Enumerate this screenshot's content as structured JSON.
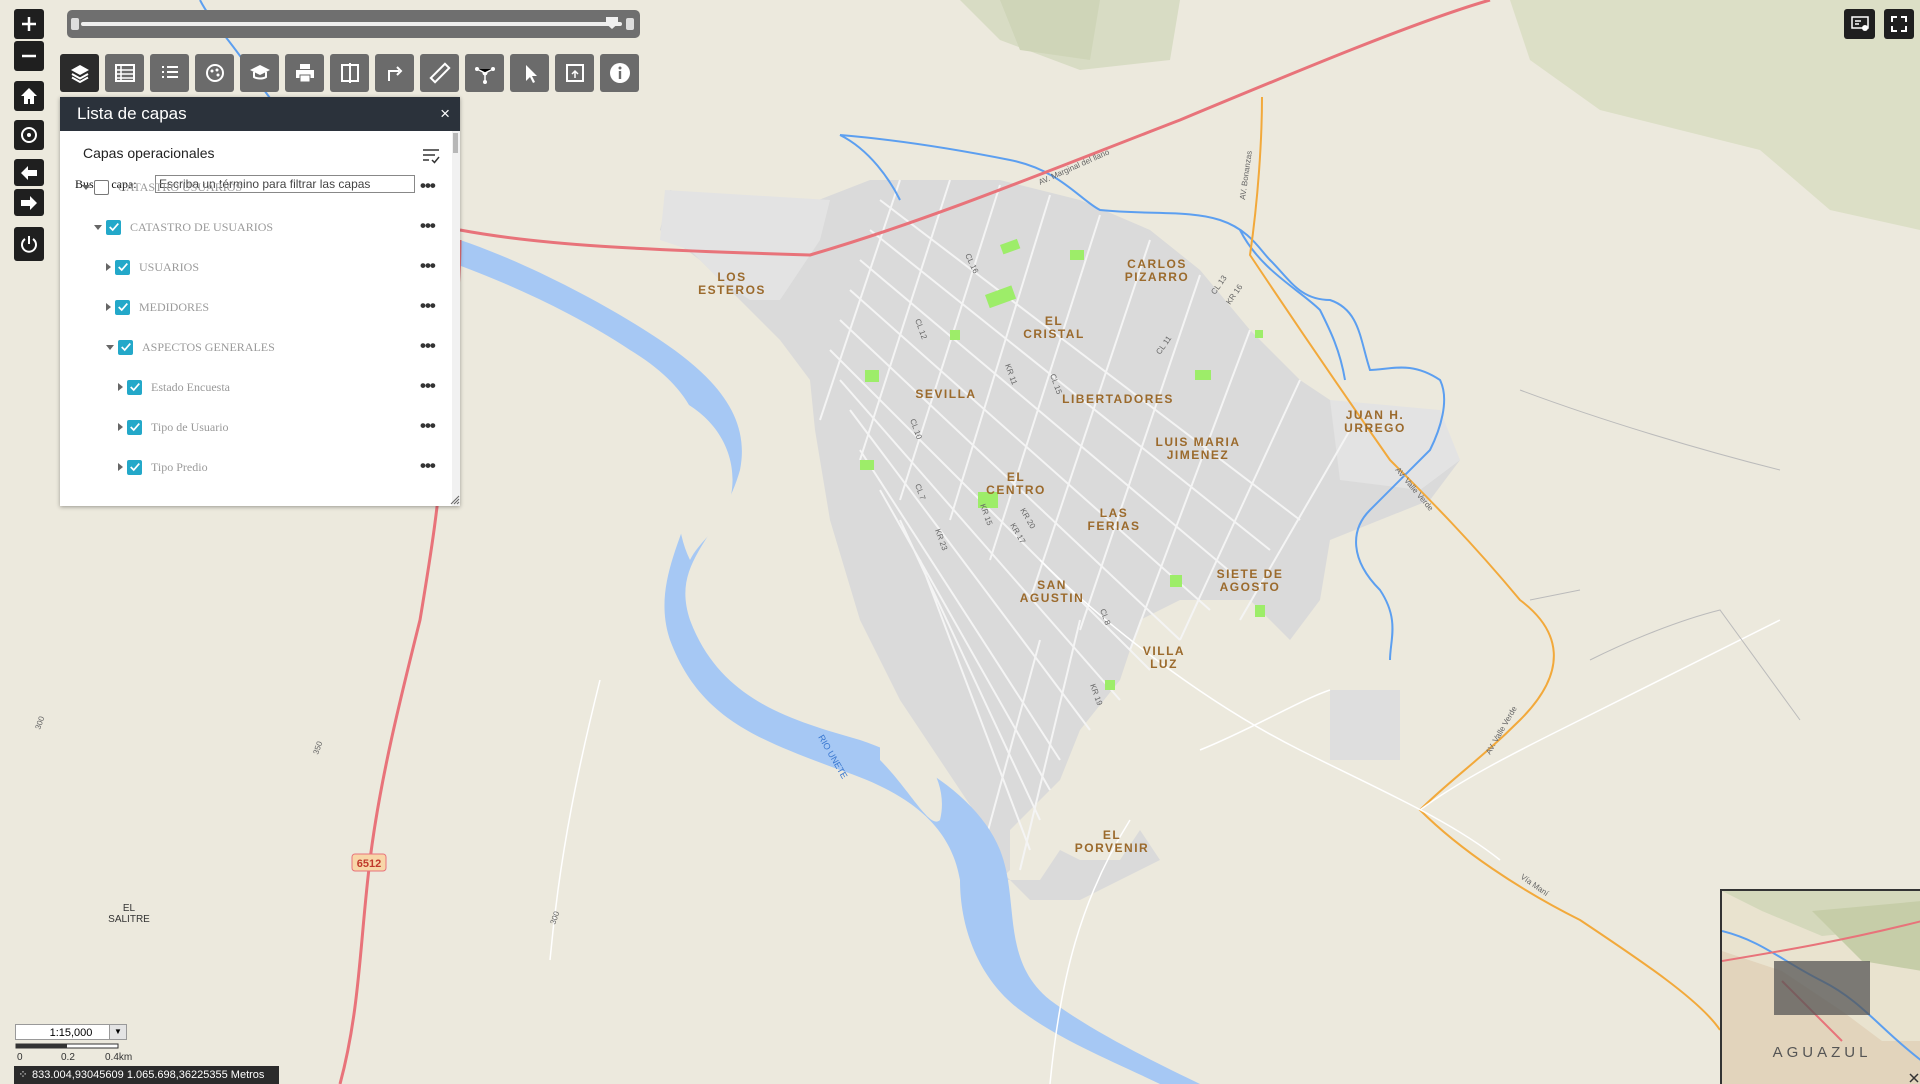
{
  "toolbar_top_right": {
    "icons": [
      "display-settings-icon",
      "fullscreen-icon"
    ]
  },
  "nav": {
    "icons": [
      "zoom-in-icon",
      "zoom-out-icon",
      "home-icon",
      "locate-icon",
      "back-icon",
      "forward-icon",
      "power-icon"
    ]
  },
  "time_slider": {
    "icon": "time-slider"
  },
  "widgets": [
    {
      "name": "layer-list-icon",
      "active": true
    },
    {
      "name": "attribute-table-icon"
    },
    {
      "name": "legend-icon"
    },
    {
      "name": "basemap-gallery-icon"
    },
    {
      "name": "about-icon"
    },
    {
      "name": "print-icon"
    },
    {
      "name": "swipe-icon"
    },
    {
      "name": "directions-icon"
    },
    {
      "name": "measure-icon"
    },
    {
      "name": "network-icon"
    },
    {
      "name": "select-icon"
    },
    {
      "name": "screening-icon"
    },
    {
      "name": "info-icon"
    }
  ],
  "layer_panel": {
    "title": "Lista de capas",
    "close": "×",
    "subtitle": "Capas operacionales",
    "search_label": "Buscar capa:",
    "search_placeholder": "Escriba un término para filtrar las capas",
    "layers": [
      {
        "label": "CATASTRO USUARIOS",
        "checked": false,
        "expanded": true,
        "level": 0
      },
      {
        "label": "CATASTRO DE USUARIOS",
        "checked": true,
        "expanded": true,
        "level": 1
      },
      {
        "label": "USUARIOS",
        "checked": true,
        "expanded": false,
        "level": 2
      },
      {
        "label": "MEDIDORES",
        "checked": true,
        "expanded": false,
        "level": 2
      },
      {
        "label": "ASPECTOS GENERALES",
        "checked": true,
        "expanded": true,
        "level": 2
      },
      {
        "label": "Estado Encuesta",
        "checked": true,
        "expanded": false,
        "level": 3
      },
      {
        "label": "Tipo de Usuario",
        "checked": true,
        "expanded": false,
        "level": 3
      },
      {
        "label": "Tipo Predio",
        "checked": true,
        "expanded": false,
        "level": 3
      }
    ],
    "more_label": "•••"
  },
  "map": {
    "neighborhoods": [
      [
        "LOS",
        "ESTEROS"
      ],
      [
        "EL",
        "CRISTAL"
      ],
      [
        "CARLOS",
        "PIZARRO"
      ],
      [
        "SEVILLA"
      ],
      [
        "LIBERTADORES"
      ],
      [
        "JUAN H.",
        "URREGO"
      ],
      [
        "LUIS MARIA",
        "JIMENEZ"
      ],
      [
        "EL",
        "CENTRO"
      ],
      [
        "LAS",
        "FERIAS"
      ],
      [
        "SAN",
        "AGUSTIN"
      ],
      [
        "SIETE DE",
        "AGOSTO"
      ],
      [
        "VILLA",
        "LUZ"
      ],
      [
        "EL",
        "PORVENIR"
      ]
    ],
    "places": [
      "EL",
      "SALITRE"
    ],
    "route_shield": "6512",
    "river_label": "RIO UNETE",
    "road_labels": [
      "AV. Marginal del llano",
      "AV. Bonanzas",
      "AV. Valle Verde",
      "Vía Maní"
    ],
    "contours": [
      "300",
      "350",
      "300"
    ],
    "street_labels": [
      "CL 16",
      "CL 12",
      "CL 10",
      "CL 15",
      "KR 11",
      "KR 15",
      "KR 17",
      "KR 20",
      "KR 23",
      "CL 7",
      "CL 8",
      "CL 11",
      "CL 13",
      "KR 16",
      "KR 19"
    ]
  },
  "scale": {
    "ratio": "1:15,000",
    "ticks": [
      "0",
      "0.2",
      "0.4km"
    ]
  },
  "coordinates": "833.004,93045609 1.065.698,36225355 Metros",
  "overview": {
    "label": "AGUAZUL"
  },
  "colors": {
    "background": "#ece9dd",
    "river": "#a6c8f4",
    "stream": "#5c9ff0",
    "highway": "#e8737a",
    "main_road": "#f2a93b",
    "urban": "#dcdcdc",
    "park": "#9ded69",
    "neighborhood_label": "#9b6a2c",
    "panel_header": "#2b323b",
    "checkbox": "#23a8c9"
  }
}
